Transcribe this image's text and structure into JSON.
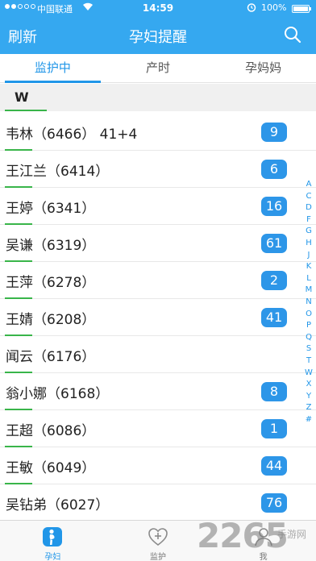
{
  "status": {
    "carrier": "中国联通",
    "time": "14:59",
    "battery": "100%"
  },
  "nav": {
    "refresh_label": "刷新",
    "title": "孕妇提醒"
  },
  "tabs": [
    {
      "label": "监护中"
    },
    {
      "label": "产时"
    },
    {
      "label": "孕妈妈"
    }
  ],
  "section": {
    "letter": "W"
  },
  "patients": [
    {
      "name": "韦林（6466）  41+4",
      "count": "9"
    },
    {
      "name": "王江兰（6414）",
      "count": "6"
    },
    {
      "name": "王婷（6341）",
      "count": "16"
    },
    {
      "name": "吴谦（6319）",
      "count": "61"
    },
    {
      "name": "王萍（6278）",
      "count": "2"
    },
    {
      "name": "王婧（6208）",
      "count": "41"
    },
    {
      "name": "闻云（6176）",
      "count": ""
    },
    {
      "name": "翁小娜（6168）",
      "count": "8"
    },
    {
      "name": "王超（6086）",
      "count": "1"
    },
    {
      "name": "王敏（6049）",
      "count": "44"
    },
    {
      "name": "吴钻弟（6027）",
      "count": "76"
    }
  ],
  "index_letters": [
    "A",
    "C",
    "D",
    "F",
    "G",
    "H",
    "J",
    "K",
    "L",
    "M",
    "N",
    "O",
    "P",
    "Q",
    "S",
    "T",
    "W",
    "X",
    "Y",
    "Z",
    "#"
  ],
  "tabbar": [
    {
      "label": "孕妇",
      "icon": "pregnant-woman-icon"
    },
    {
      "label": "监护",
      "icon": "heart-plus-icon"
    },
    {
      "label": "我",
      "icon": "person-icon"
    }
  ],
  "watermark": {
    "number": "2265",
    "text": "手游网"
  },
  "colors": {
    "primary": "#35a8f0",
    "badge": "#2d96e8",
    "accent": "#39b54a"
  }
}
